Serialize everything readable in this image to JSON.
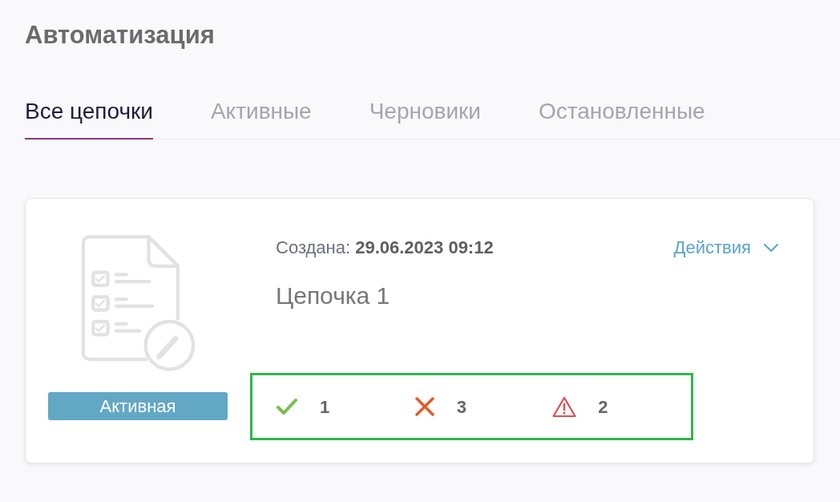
{
  "page": {
    "title": "Автоматизация"
  },
  "tabs": [
    {
      "label": "Все цепочки",
      "selected": true
    },
    {
      "label": "Активные",
      "selected": false
    },
    {
      "label": "Черновики",
      "selected": false
    },
    {
      "label": "Остановленные",
      "selected": false
    }
  ],
  "chains": [
    {
      "status": {
        "label": "Активная",
        "kind": "active"
      },
      "created": "Создана: **29.06.2023 09:12**",
      "name": "Цепочка 1",
      "actions_label": "Действия",
      "highlighted": true,
      "stats": [
        {
          "kind": "success",
          "count": "1"
        },
        {
          "kind": "error",
          "count": "3"
        },
        {
          "kind": "warning",
          "count": "2"
        }
      ]
    }
  ]
}
